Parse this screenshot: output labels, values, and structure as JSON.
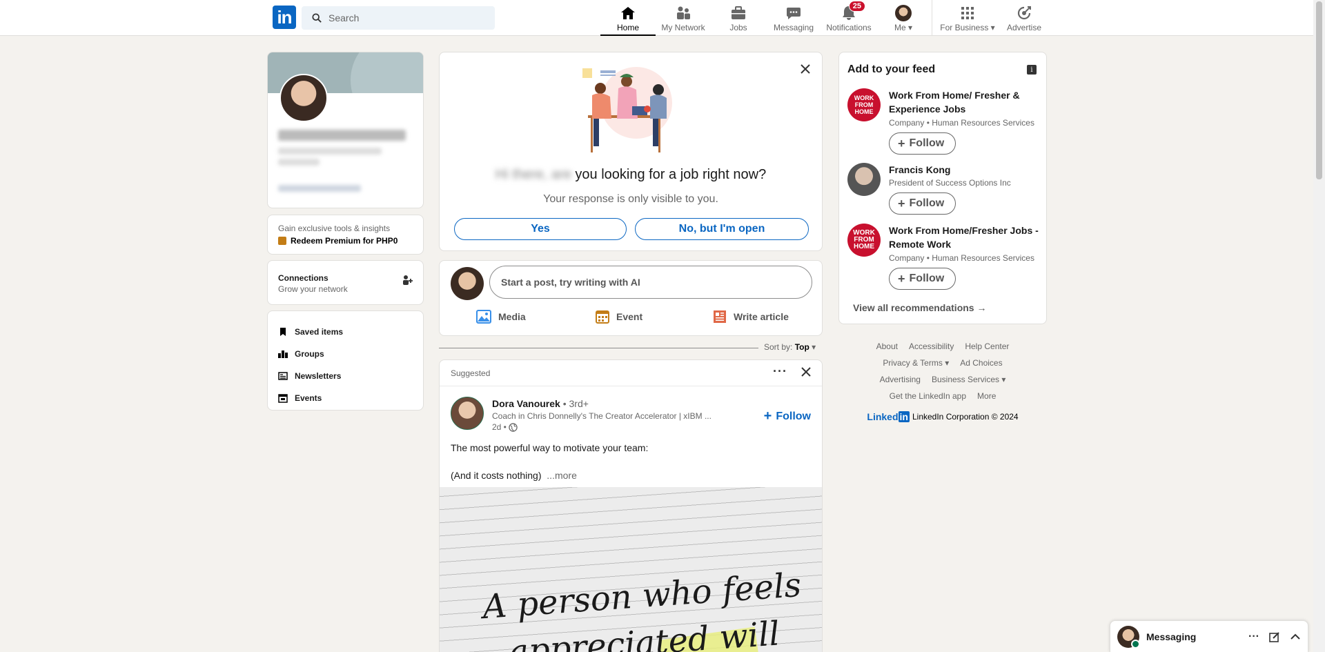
{
  "colors": {
    "brand": "#0a66c2",
    "badge": "#cb112d",
    "premium": "#c37d16"
  },
  "header": {
    "logo": "in",
    "search_placeholder": "Search",
    "nav": [
      {
        "label": "Home",
        "icon": "home-icon"
      },
      {
        "label": "My Network",
        "icon": "network-icon"
      },
      {
        "label": "Jobs",
        "icon": "briefcase-icon"
      },
      {
        "label": "Messaging",
        "icon": "chat-icon"
      },
      {
        "label": "Notifications",
        "icon": "bell-icon",
        "badge": "25"
      },
      {
        "label": "Me",
        "icon": "avatar"
      },
      {
        "label": "For Business",
        "icon": "grid-icon"
      },
      {
        "label": "Advertise",
        "icon": "advertise-icon"
      }
    ]
  },
  "left": {
    "premium": {
      "sub": "Gain exclusive tools & insights",
      "link": "Redeem Premium for PHP0"
    },
    "connections": {
      "title": "Connections",
      "sub": "Grow your network"
    },
    "links": [
      "Saved items",
      "Groups",
      "Newsletters",
      "Events"
    ]
  },
  "job_prompt": {
    "question_blurred": "Hi there, are",
    "question": "you looking for a job right now?",
    "sub": "Your response is only visible to you.",
    "yes": "Yes",
    "no": "No, but I'm open"
  },
  "composer": {
    "placeholder": "Start a post, try writing with AI",
    "media": "Media",
    "event": "Event",
    "article": "Write article"
  },
  "sort": {
    "label": "Sort by:",
    "value": "Top"
  },
  "post": {
    "tag": "Suggested",
    "author": "Dora Vanourek",
    "degree": "• 3rd+",
    "title": "Coach in Chris Donnelly's The Creator Accelerator | xIBM ...",
    "time": "2d •",
    "follow": "Follow",
    "line1": "The most powerful way to motivate your team:",
    "line2": "(And it costs nothing)",
    "more": "...more",
    "image_text": "A person who feels",
    "image_text2": "appreciated will"
  },
  "reco": {
    "title": "Add to your feed",
    "items": [
      {
        "name": "Work From Home/ Fresher & Experience Jobs",
        "desc": "Company • Human Resources Services",
        "follow": "Follow",
        "logo": "WORK FROM HOME"
      },
      {
        "name": "Francis Kong",
        "desc": "President of Success Options Inc",
        "follow": "Follow"
      },
      {
        "name": "Work From Home/Fresher Jobs - Remote Work",
        "desc": "Company • Human Resources Services",
        "follow": "Follow",
        "logo": "WORK FROM HOME"
      }
    ],
    "view_all": "View all recommendations"
  },
  "footer": {
    "row1": [
      "About",
      "Accessibility",
      "Help Center"
    ],
    "row2": [
      "Privacy & Terms",
      "Ad Choices"
    ],
    "row3": [
      "Advertising",
      "Business Services"
    ],
    "row4": [
      "Get the LinkedIn app",
      "More"
    ],
    "brand_li": "Linked",
    "brand_in": "in",
    "copyright": "LinkedIn Corporation © 2024"
  },
  "messaging": {
    "label": "Messaging"
  }
}
